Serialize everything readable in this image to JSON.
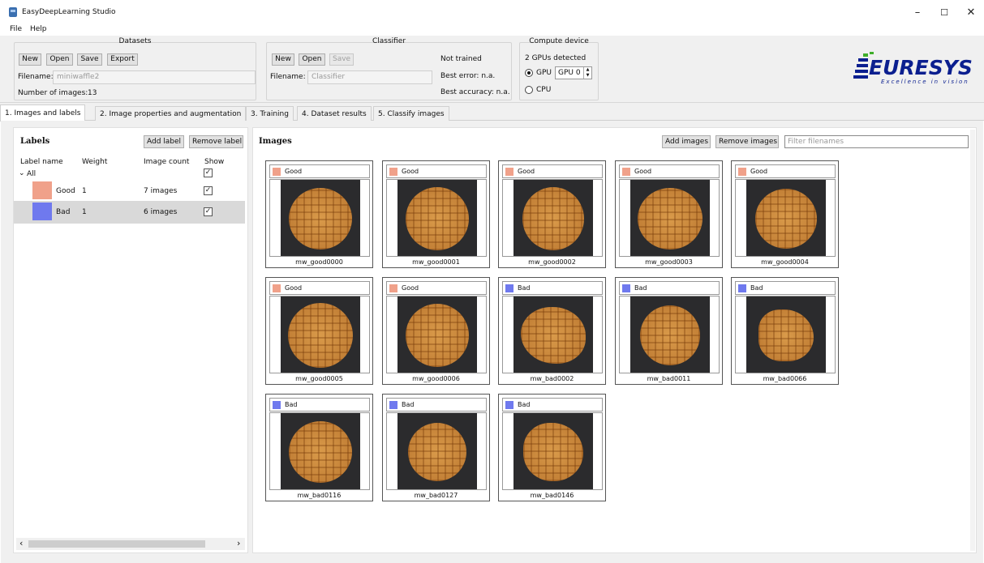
{
  "window": {
    "title": "EasyDeepLearning Studio",
    "min": "–",
    "max": "☐",
    "close": "✕"
  },
  "menu": [
    "File",
    "Help"
  ],
  "datasets": {
    "title": "Datasets",
    "new": "New",
    "open": "Open",
    "save": "Save",
    "export": "Export",
    "filename_label": "Filename:",
    "filename_value": "miniwaffle2",
    "count_label": "Number of images:",
    "count_value": "13"
  },
  "classifier": {
    "title": "Classifier",
    "new": "New",
    "open": "Open",
    "save": "Save",
    "filename_label": "Filename:",
    "filename_placeholder": "Classifier",
    "status": "Not trained",
    "best_error": "Best error: n.a.",
    "best_accuracy": "Best accuracy: n.a."
  },
  "compute": {
    "title": "Compute device",
    "detected": "2 GPUs detected",
    "gpu_label": "GPU",
    "gpu_value": "GPU 0",
    "cpu_label": "CPU",
    "selected": "GPU"
  },
  "logo": {
    "brand": "EURESYS",
    "tagline": "Excellence in vision",
    "color": "#0b1f8f"
  },
  "tabs": [
    "1. Images and labels",
    "2. Image properties and augmentation",
    "3. Training",
    "4. Dataset results",
    "5. Classify images"
  ],
  "labels_panel": {
    "title": "Labels",
    "add": "Add label",
    "remove": "Remove label",
    "col_name": "Label name",
    "col_weight": "Weight",
    "col_count": "Image count",
    "col_show": "Show",
    "all": "All",
    "rows": [
      {
        "name": "Good",
        "weight": "1",
        "count": "7 images",
        "color": "#f0a18a"
      },
      {
        "name": "Bad",
        "weight": "1",
        "count": "6 images",
        "color": "#6f79ee"
      }
    ]
  },
  "images_panel": {
    "title": "Images",
    "add": "Add images",
    "remove": "Remove images",
    "filter_placeholder": "Filter filenames",
    "cards": [
      {
        "label": "Good",
        "color": "#f0a18a",
        "name": "mw_good0000"
      },
      {
        "label": "Good",
        "color": "#f0a18a",
        "name": "mw_good0001"
      },
      {
        "label": "Good",
        "color": "#f0a18a",
        "name": "mw_good0002"
      },
      {
        "label": "Good",
        "color": "#f0a18a",
        "name": "mw_good0003"
      },
      {
        "label": "Good",
        "color": "#f0a18a",
        "name": "mw_good0004"
      },
      {
        "label": "Good",
        "color": "#f0a18a",
        "name": "mw_good0005"
      },
      {
        "label": "Good",
        "color": "#f0a18a",
        "name": "mw_good0006"
      },
      {
        "label": "Bad",
        "color": "#6f79ee",
        "name": "mw_bad0002"
      },
      {
        "label": "Bad",
        "color": "#6f79ee",
        "name": "mw_bad0011"
      },
      {
        "label": "Bad",
        "color": "#6f79ee",
        "name": "mw_bad0066"
      },
      {
        "label": "Bad",
        "color": "#6f79ee",
        "name": "mw_bad0116"
      },
      {
        "label": "Bad",
        "color": "#6f79ee",
        "name": "mw_bad0127"
      },
      {
        "label": "Bad",
        "color": "#6f79ee",
        "name": "mw_bad0146"
      }
    ]
  },
  "scroll": {
    "left": "‹",
    "right": "›"
  }
}
